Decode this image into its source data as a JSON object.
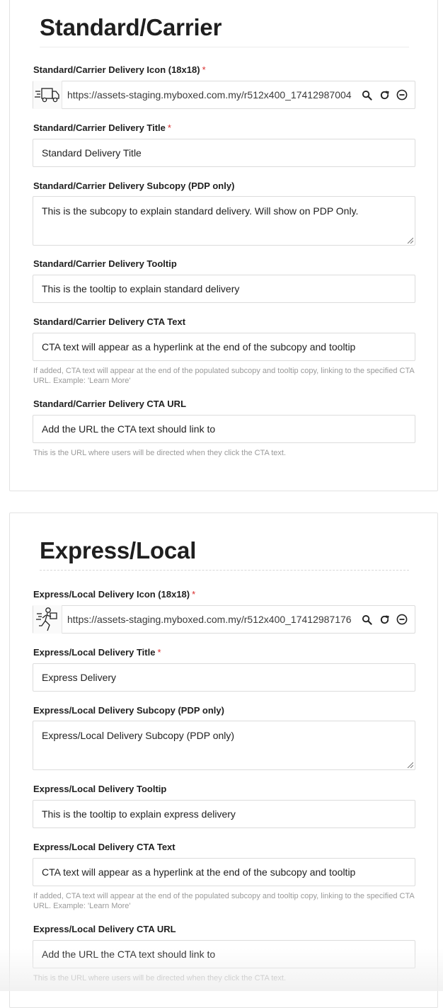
{
  "standard": {
    "title": "Standard/Carrier",
    "icon_label": "Standard/Carrier Delivery Icon (18x18)",
    "icon_url": "https://assets-staging.myboxed.com.my/r512x400_17412987004",
    "icon_name": "delivery-truck-icon",
    "title_label": "Standard/Carrier Delivery Title",
    "title_value": "Standard Delivery Title",
    "subcopy_label": "Standard/Carrier Delivery Subcopy (PDP only)",
    "subcopy_value": "This is the subcopy to explain standard delivery. Will show on PDP Only.",
    "tooltip_label": "Standard/Carrier Delivery Tooltip",
    "tooltip_value": "This is the tooltip to explain standard delivery",
    "cta_text_label": "Standard/Carrier Delivery CTA Text",
    "cta_text_placeholder": "CTA text will appear as a hyperlink at the end of the subcopy and tooltip",
    "cta_text_help": "If added, CTA text will appear at the end of the populated subcopy and tooltip copy, linking to the specified CTA URL. Example: 'Learn More'",
    "cta_url_label": "Standard/Carrier Delivery CTA URL",
    "cta_url_placeholder": "Add the URL the CTA text should link to",
    "cta_url_help": "This is the URL where users will be directed when they click the CTA text."
  },
  "express": {
    "title": "Express/Local",
    "icon_label": "Express/Local Delivery Icon (18x18)",
    "icon_url": "https://assets-staging.myboxed.com.my/r512x400_17412987176",
    "icon_name": "courier-running-icon",
    "title_label": "Express/Local Delivery Title",
    "title_value": "Express Delivery",
    "subcopy_label": "Express/Local Delivery Subcopy (PDP only)",
    "subcopy_value": "Express/Local Delivery Subcopy (PDP only)",
    "tooltip_label": "Express/Local Delivery Tooltip",
    "tooltip_value": "This is the tooltip to explain express delivery",
    "cta_text_label": "Express/Local Delivery CTA Text",
    "cta_text_placeholder": "CTA text will appear as a hyperlink at the end of the subcopy and tooltip",
    "cta_text_help": "If added, CTA text will appear at the end of the populated subcopy and tooltip copy, linking to the specified CTA URL. Example: 'Learn More'",
    "cta_url_label": "Express/Local Delivery CTA URL",
    "cta_url_placeholder": "Add the URL the CTA text should link to",
    "cta_url_help": "This is the URL where users will be directed when they click the CTA text."
  },
  "required_marker": "*",
  "actions": [
    "search-icon",
    "refresh-icon",
    "remove-icon"
  ],
  "colors": {
    "required": "#d92c2c",
    "help_text": "#9a9a9a",
    "border": "#dcdcdc"
  }
}
